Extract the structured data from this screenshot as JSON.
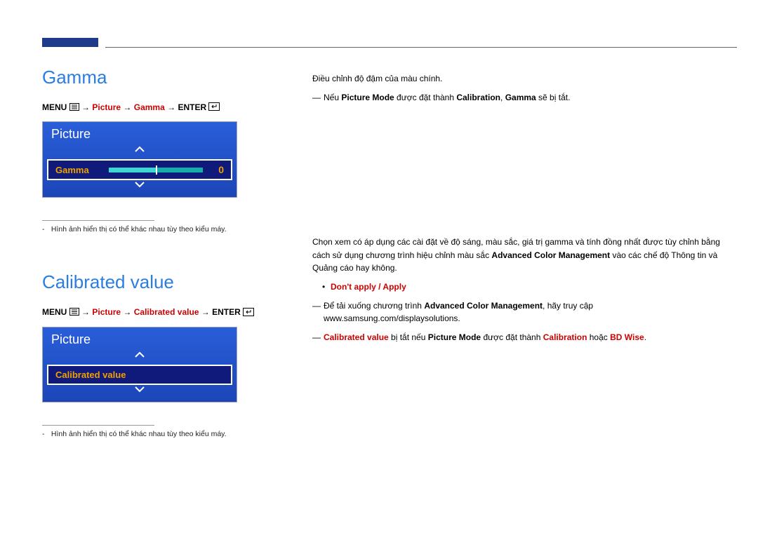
{
  "top": {},
  "section1": {
    "heading": "Gamma",
    "menupath": {
      "menu": "MENU",
      "p1": "Picture",
      "p2": "Gamma",
      "enter": "ENTER"
    },
    "osd": {
      "title": "Picture",
      "row_label": "Gamma",
      "row_value": "0"
    },
    "footnote": "Hình ảnh hiển thị có thể khác nhau tùy theo kiểu máy.",
    "right_line1": "Điều chỉnh độ đậm của màu chính.",
    "right_note_prefix": "Nếu ",
    "right_note_b1": "Picture Mode",
    "right_note_mid": " được đặt thành ",
    "right_note_b2": "Calibration",
    "right_note_comma": ", ",
    "right_note_b3": "Gamma",
    "right_note_suffix": " sẽ bị tắt."
  },
  "section2": {
    "heading": "Calibrated value",
    "menupath": {
      "menu": "MENU",
      "p1": "Picture",
      "p2": "Calibrated value",
      "enter": "ENTER"
    },
    "osd": {
      "title": "Picture",
      "row_label": "Calibrated value"
    },
    "footnote": "Hình ảnh hiển thị có thể khác nhau tùy theo kiểu máy.",
    "right_para_a": "Chọn xem có áp dụng các cài đặt về độ sáng, màu sắc, giá trị gamma và tính đồng nhất được tùy chỉnh bằng cách sử dụng chương trình hiệu chỉnh màu sắc ",
    "right_para_b": "Advanced Color Management",
    "right_para_c": " vào các chế độ Thông tin và Quảng cáo hay không.",
    "bullet": "Don't apply / Apply",
    "note2_a": "Để tải xuống chương trình ",
    "note2_b": "Advanced Color Management",
    "note2_c": ", hãy truy cập www.samsung.com/displaysolutions.",
    "note3_a": "Calibrated value",
    "note3_b": " bị tắt nếu ",
    "note3_c": "Picture Mode",
    "note3_d": " được đặt thành ",
    "note3_e": "Calibration",
    "note3_f": " hoặc ",
    "note3_g": "BD Wise",
    "note3_h": "."
  }
}
